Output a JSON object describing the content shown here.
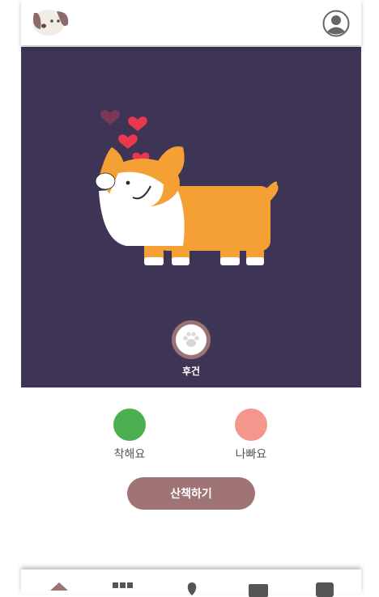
{
  "header": {
    "logo_icon": "dog-face-icon",
    "profile_icon": "user-circle-icon"
  },
  "stage": {
    "background": "#3e3456",
    "character": "corgi-with-hearts",
    "badge_icon": "paw-icon",
    "badge_label": "후건"
  },
  "choices": [
    {
      "label": "착해요",
      "color": "#4caf50"
    },
    {
      "label": "나빠요",
      "color": "#f4968b"
    }
  ],
  "walk_button": {
    "label": "산책하기",
    "color": "#a07474"
  },
  "tabbar": {
    "icons": [
      "home-icon",
      "grid-icon",
      "pin-icon",
      "calendar-icon",
      "book-icon"
    ]
  }
}
